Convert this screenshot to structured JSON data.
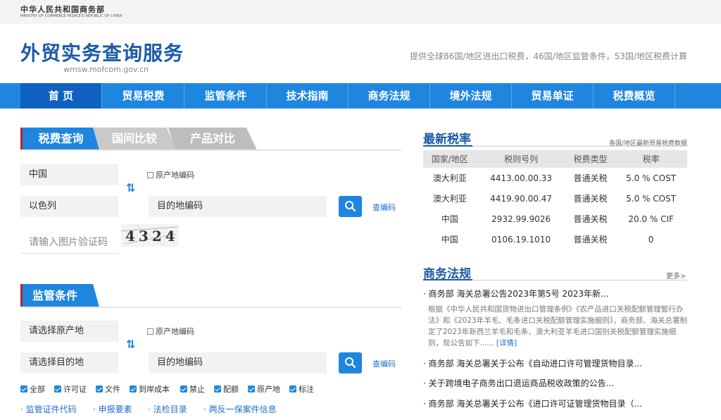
{
  "header": {
    "ministry_cn": "中华人民共和国商务部",
    "ministry_en": "MINISTRY OF COMMERCE PEOPLE'S REPUBLIC OF CHINA",
    "site_title": "外贸实务查询服务",
    "site_url": "wmsw.mofcom.gov.cn",
    "tagline": "提供全球86国/地区进出口税费，46国/地区监管条件，53国/地区税费计算"
  },
  "nav": {
    "items": [
      "首 页",
      "贸易税费",
      "监管条件",
      "技术指南",
      "商务法规",
      "境外法规",
      "贸易单证",
      "税费概览"
    ],
    "active_index": 0
  },
  "tax_query": {
    "tabs": [
      "税费查询",
      "国间比较",
      "产品对比"
    ],
    "origin_country": "中国",
    "dest_country": "以色列",
    "origin_code_checkbox": "原产地编码",
    "dest_code_placeholder": "目的地编码",
    "lookup_code_link": "查编码",
    "captcha_placeholder": "请输入图片验证码",
    "captcha_text": "4324"
  },
  "supervision": {
    "title": "监管条件",
    "origin_placeholder": "请选择原产地",
    "dest_placeholder": "请选择目的地",
    "origin_code_checkbox": "原产地编码",
    "dest_code_placeholder": "目的地编码",
    "lookup_code_link": "查编码",
    "filters": [
      "全部",
      "许可证",
      "文件",
      "到岸成本",
      "禁止",
      "配额",
      "原产地",
      "标注"
    ],
    "links": [
      "监管证件代码",
      "申报要素",
      "法检目录",
      "两反一保案件信息"
    ]
  },
  "latest_rates": {
    "title": "最新税率",
    "subtitle": "各国/地区最新贸易税费数据",
    "columns": [
      "国家/地区",
      "税则号列",
      "税费类型",
      "税率"
    ],
    "rows": [
      [
        "澳大利亚",
        "4413.00.00.33",
        "普通关税",
        "5.0 % COST"
      ],
      [
        "澳大利亚",
        "4419.90.00.47",
        "普通关税",
        "5.0 % COST"
      ],
      [
        "中国",
        "2932.99.9026",
        "普通关税",
        "20.0 % CIF"
      ],
      [
        "中国",
        "0106.19.1010",
        "普通关税",
        "0"
      ]
    ]
  },
  "regulations": {
    "title": "商务法规",
    "more": "更多>",
    "items": [
      "· 商务部 海关总署公告2023年第5号 2023年新...",
      "· 商务部 海关总署关于公布《自动进口许可管理货物目录...",
      "· 关于跨境电子商务出口退运商品税收政策的公告...",
      "· 商务部 海关总署关于公布《进口许可证管理货物目录（..."
    ],
    "first_desc": "根据《中华人民共和国货物进出口管理条例》《农产品进口关税配额管理暂行办法》和《2023年羊毛、毛条进口关税配额管理实施细则》，商务部、海关总署制定了2023年新西兰羊毛和毛条、澳大利亚羊毛进口国别关税配额管理实施细则，现公告如下......",
    "detail_link": "[详情]"
  }
}
